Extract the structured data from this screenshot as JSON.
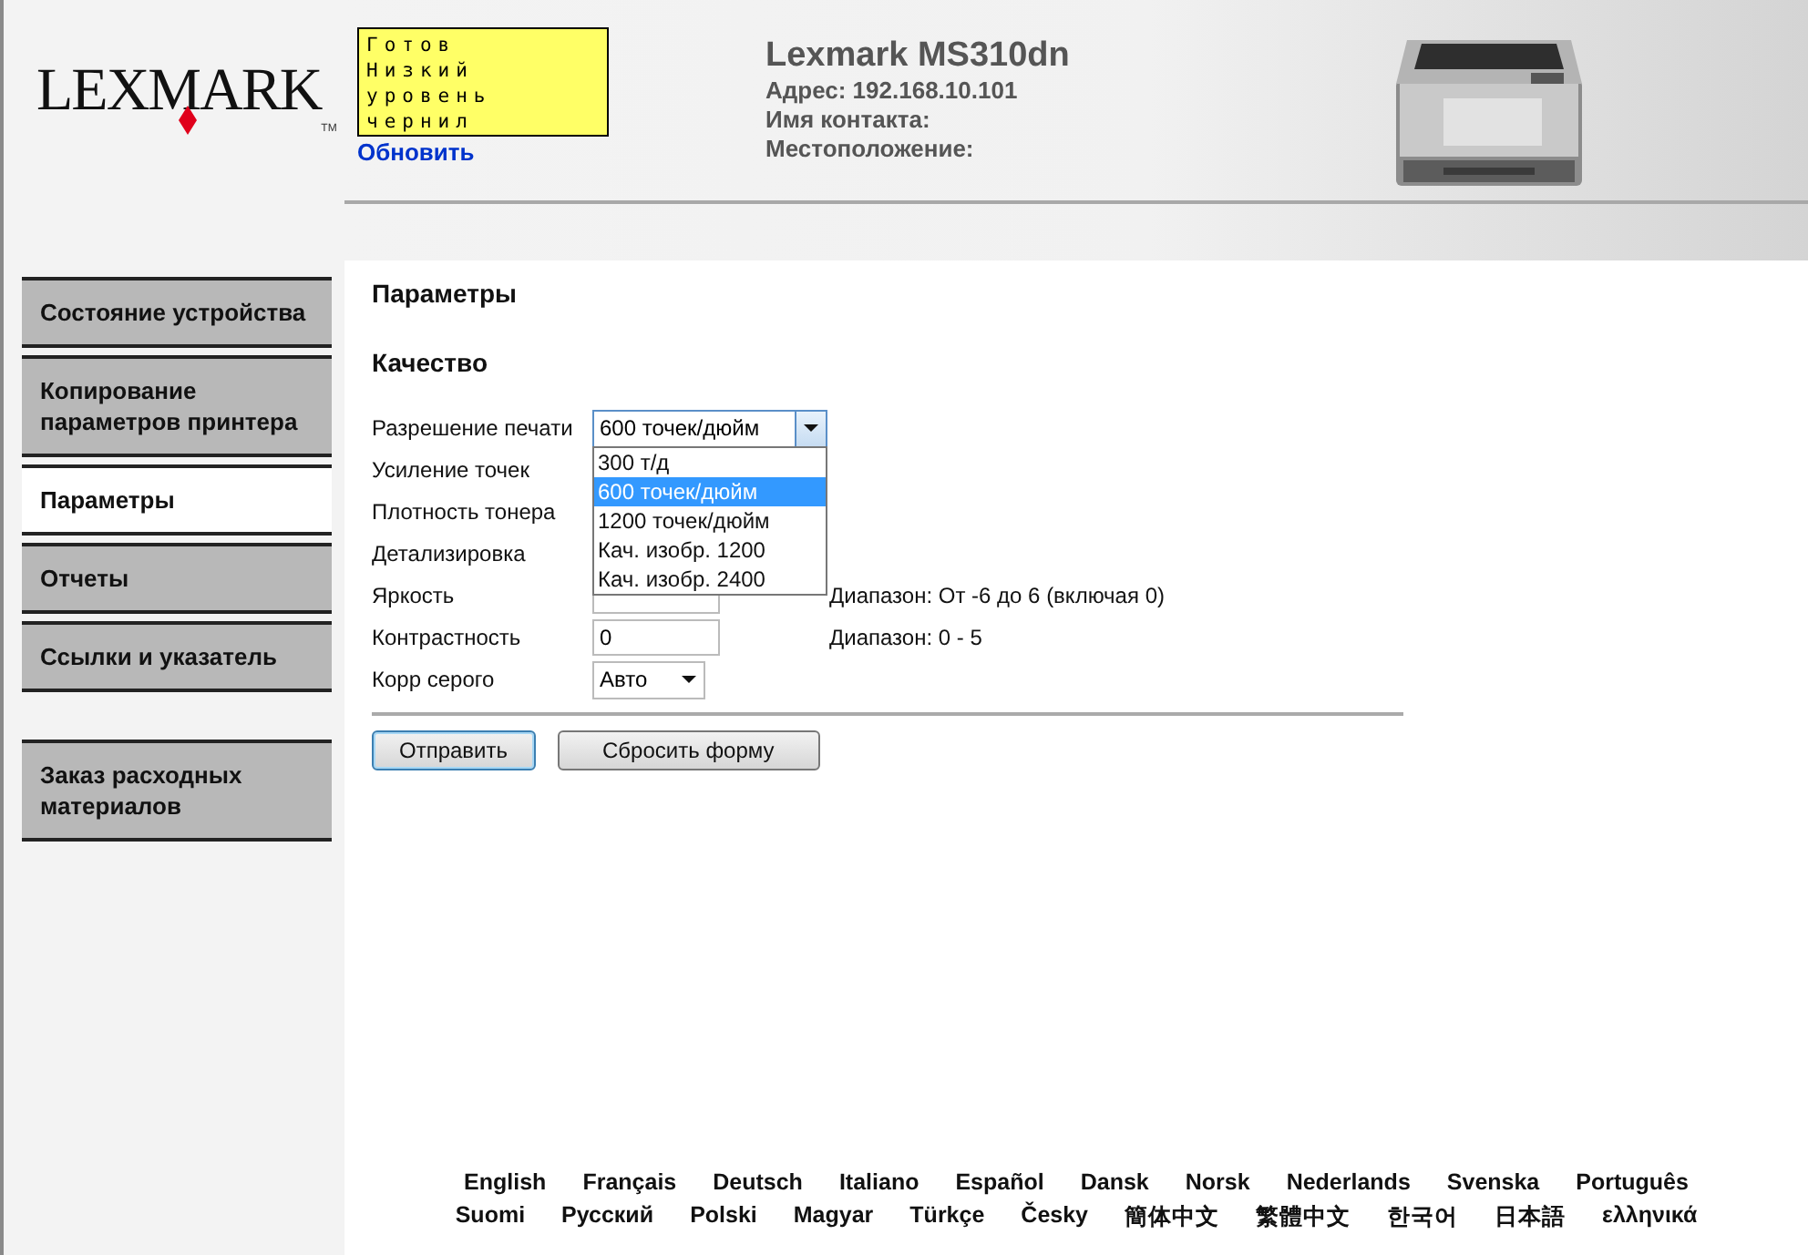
{
  "logo": {
    "text": "LEXMARK",
    "tm": "TM"
  },
  "status_panel": {
    "lines": [
      "Готов",
      "Низкий",
      "уровень",
      "чернил"
    ],
    "refresh_link": "Обновить"
  },
  "device": {
    "model": "Lexmark MS310dn",
    "address": "Адрес: 192.168.10.101",
    "contact": "Имя контакта:",
    "location": "Местоположение:"
  },
  "sidebar": {
    "items": [
      {
        "label": "Состояние устройства",
        "selected": false
      },
      {
        "label": "Копирование параметров принтера",
        "selected": false
      },
      {
        "label": "Параметры",
        "selected": true
      },
      {
        "label": "Отчеты",
        "selected": false
      },
      {
        "label": "Ссылки и указатель",
        "selected": false
      }
    ],
    "extra_items": [
      {
        "label": "Заказ расходных материалов",
        "selected": false
      }
    ]
  },
  "page_title": "Параметры",
  "section_title": "Качество",
  "form": {
    "rows": [
      {
        "kind": "select",
        "label": "Разрешение печати",
        "value": "600 точек/дюйм",
        "expanded": true,
        "options": [
          {
            "label": "300 т/д",
            "selected": false
          },
          {
            "label": "600 точек/дюйм",
            "selected": true
          },
          {
            "label": "1200 точек/дюйм",
            "selected": false
          },
          {
            "label": "Кач. изобр. 1200",
            "selected": false
          },
          {
            "label": "Кач. изобр. 2400",
            "selected": false
          }
        ]
      },
      {
        "kind": "hidden",
        "label": "Усиление точек"
      },
      {
        "kind": "hidden",
        "label": "Плотность тонера"
      },
      {
        "kind": "hidden",
        "label": "Детализировка"
      },
      {
        "kind": "input",
        "label": "Яркость",
        "hint": "Диапазон: От -6 до 6 (включая 0)"
      },
      {
        "kind": "input",
        "label": "Контрастность",
        "value": "0",
        "hint": "Диапазон: 0 - 5"
      },
      {
        "kind": "select",
        "label": "Корр серого",
        "value": "Авто",
        "expanded": false
      }
    ],
    "buttons": [
      {
        "label": "Отправить",
        "focused": true
      },
      {
        "label": "Сбросить форму",
        "focused": false
      }
    ]
  },
  "languages": [
    [
      "English",
      "Français",
      "Deutsch",
      "Italiano",
      "Español",
      "Dansk",
      "Norsk",
      "Nederlands",
      "Svenska",
      "Português"
    ],
    [
      "Suomi",
      "Русский",
      "Polski",
      "Magyar",
      "Türkçe",
      "Česky",
      "簡体中文",
      "繁體中文",
      "한국어",
      "日本語",
      "ελληνικά"
    ]
  ]
}
